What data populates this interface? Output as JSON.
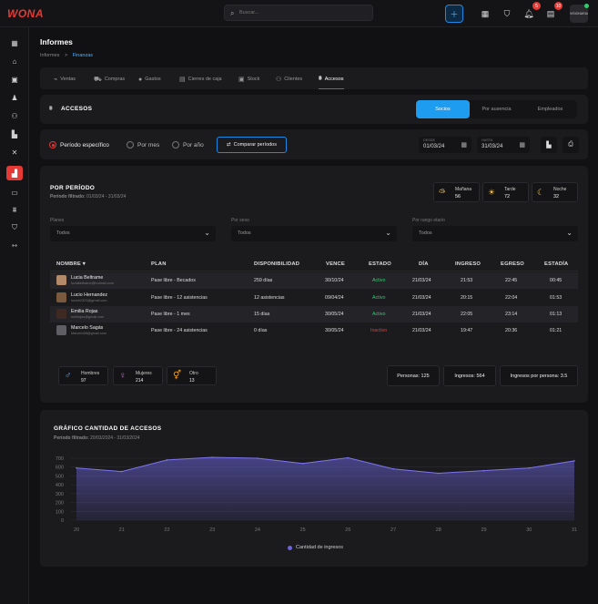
{
  "app": {
    "logo": "WONA"
  },
  "search": {
    "placeholder": "Buscar..."
  },
  "topbar": {
    "notif_count": "5",
    "msg_count": "10",
    "user_label": "VISIONARIA"
  },
  "page": {
    "title": "Informes",
    "breadcrumb": [
      "Informes",
      ">",
      "Finanzas"
    ]
  },
  "tabs": [
    {
      "label": "Ventas",
      "icon": "chart-icon"
    },
    {
      "label": "Compras",
      "icon": "cart-icon"
    },
    {
      "label": "Gastos",
      "icon": "money-icon"
    },
    {
      "label": "Cierres de caja",
      "icon": "register-icon"
    },
    {
      "label": "Stock",
      "icon": "box-icon"
    },
    {
      "label": "Clientes",
      "icon": "users-icon"
    },
    {
      "label": "Accesos",
      "icon": "gate-icon"
    }
  ],
  "accesos": {
    "title": "ACCESOS",
    "segments": [
      "Socios",
      "Por ausencia",
      "Empleados"
    ]
  },
  "period": {
    "options": [
      "Período específico",
      "Por mes",
      "Por año"
    ],
    "compare_label": "Comparar períodos",
    "from_label": "DESDE",
    "from": "01/03/24",
    "to_label": "HASTA",
    "to": "31/03/24"
  },
  "por_periodo": {
    "title": "POR PERÍODO",
    "filter_label": "Período filtrado:",
    "filter_value": "01/03/24 - 31/03/24",
    "shifts": [
      {
        "name": "Mañana",
        "count": "56"
      },
      {
        "name": "Tarde",
        "count": "72"
      },
      {
        "name": "Noche",
        "count": "32"
      }
    ],
    "filters": [
      {
        "label": "Planes",
        "value": "Todos"
      },
      {
        "label": "Por sexo",
        "value": "Todos"
      },
      {
        "label": "Por rango etario",
        "value": "Todos"
      }
    ]
  },
  "table": {
    "headers": [
      "NOMBRE",
      "PLAN",
      "DISPONIBILIDAD",
      "VENCE",
      "ESTADO",
      "DÍA",
      "INGRESO",
      "EGRESO",
      "ESTADÍA"
    ],
    "rows": [
      {
        "name": "Lucia Beltrame",
        "email": "luciabeltrame@hotmail.com",
        "plan": "Pase libre - Becados",
        "disp": "259 días",
        "vence": "30/10/24",
        "estado": "Activo",
        "dia": "21/03/24",
        "ingreso": "21:53",
        "egreso": "22:45",
        "estadia": "00:45"
      },
      {
        "name": "Lucio Hernandez",
        "email": "lucioh2323@gmail.com",
        "plan": "Pase libre - 12 asistencias",
        "disp": "12 asistencias",
        "vence": "09/04/24",
        "estado": "Activo",
        "dia": "21/03/24",
        "ingreso": "20:15",
        "egreso": "22:04",
        "estadia": "01:53"
      },
      {
        "name": "Emilia Rojas",
        "email": "emilrojas@gmail.com",
        "plan": "Pase libre - 1 mes",
        "disp": "15 días",
        "vence": "30/05/24",
        "estado": "Activo",
        "dia": "21/03/24",
        "ingreso": "22:05",
        "egreso": "23:14",
        "estadia": "01:13"
      },
      {
        "name": "Marcelo Sagás",
        "email": "Marcelo58@gmail.com",
        "plan": "Pase libre - 24 asistencias",
        "disp": "0 días",
        "vence": "30/05/24",
        "estado": "Inactivo",
        "dia": "21/03/24",
        "ingreso": "19:47",
        "egreso": "20:36",
        "estadia": "01:21"
      }
    ]
  },
  "genders": [
    {
      "name": "Hombres",
      "count": "97"
    },
    {
      "name": "Mujeres",
      "count": "214"
    },
    {
      "name": "Otro",
      "count": "13"
    }
  ],
  "stats": [
    "Personas: 125",
    "Ingresos: 564",
    "Ingresos por persona: 3.5"
  ],
  "chart_section": {
    "title": "GRÁFICO CANTIDAD DE ACCESOS",
    "filter_label": "Período filtrado:",
    "filter_value": "20/03/2024 - 31/03/2024"
  },
  "chart_data": {
    "type": "area",
    "x": [
      "20",
      "21",
      "22",
      "23",
      "24",
      "25",
      "26",
      "27",
      "28",
      "29",
      "30",
      "31"
    ],
    "series": [
      {
        "name": "Cantidad de ingresos",
        "values": [
          590,
          550,
          680,
          710,
          700,
          640,
          705,
          580,
          530,
          560,
          590,
          670
        ]
      }
    ],
    "yticks": [
      0,
      100,
      200,
      300,
      400,
      500,
      600,
      700
    ],
    "ylim": [
      0,
      700
    ],
    "color": "#6b63d9",
    "grid": true,
    "legend": "bottom-center"
  }
}
